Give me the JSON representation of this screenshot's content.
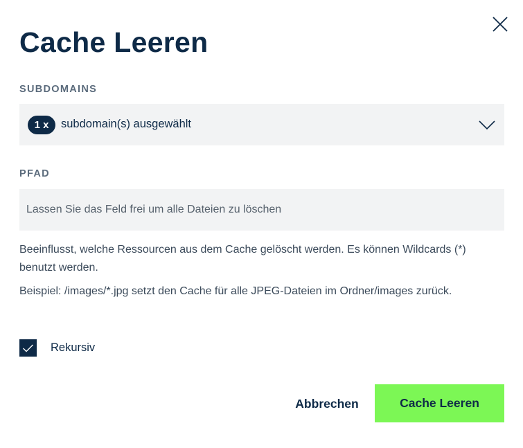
{
  "dialog": {
    "title": "Cache Leeren",
    "close_icon": "close-icon"
  },
  "subdomains": {
    "label": "SUBDOMAINS",
    "count_badge": "1 x",
    "selected_text": "subdomain(s) ausgewählt",
    "chevron_icon": "chevron-down-icon"
  },
  "path": {
    "label": "PFAD",
    "value": "",
    "placeholder": "Lassen Sie das Feld frei um alle Dateien zu löschen"
  },
  "help": {
    "line1": "Beeinflusst, welche Ressourcen aus dem Cache gelöscht werden. Es können Wildcards (*) benutzt werden.",
    "line2": "Beispiel: /images/*.jpg setzt den Cache für alle JPEG-Dateien im Ordner/images zurück."
  },
  "recursive": {
    "label": "Rekursiv",
    "checked": true
  },
  "actions": {
    "cancel_label": "Abbrechen",
    "submit_label": "Cache Leeren"
  },
  "colors": {
    "text_primary": "#0e2a47",
    "field_bg": "#f2f3f4",
    "accent_green": "#7cf755",
    "label_gray": "#5b6b7c"
  }
}
